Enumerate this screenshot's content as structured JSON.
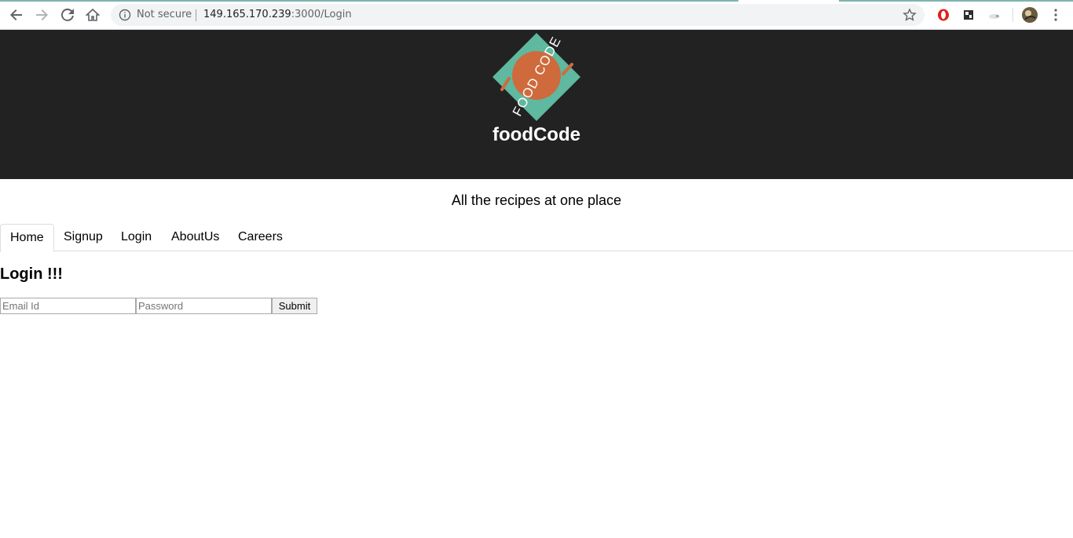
{
  "browser": {
    "security_label": "Not secure",
    "url_host": "149.165.170.239",
    "url_path": ":3000/Login",
    "icons": [
      "back-icon",
      "forward-icon",
      "reload-icon",
      "home-icon",
      "info-icon",
      "star-icon",
      "opera-icon",
      "extension-icon",
      "cloud-icon",
      "avatar-icon",
      "menu-icon"
    ]
  },
  "site": {
    "brand": "foodCode",
    "logo_text": "FOOD CODE",
    "tagline": "All the recipes at one place",
    "colors": {
      "header_bg": "#222222",
      "logo_teal": "#5fb8a0",
      "logo_orange": "#cf6a3c"
    }
  },
  "nav": {
    "tabs": [
      {
        "label": "Home",
        "active": true
      },
      {
        "label": "Signup",
        "active": false
      },
      {
        "label": "Login",
        "active": false
      },
      {
        "label": "AboutUs",
        "active": false
      },
      {
        "label": "Careers",
        "active": false
      }
    ]
  },
  "login": {
    "title": "Login !!!",
    "email_placeholder": "Email Id",
    "password_placeholder": "Password",
    "submit_label": "Submit"
  }
}
